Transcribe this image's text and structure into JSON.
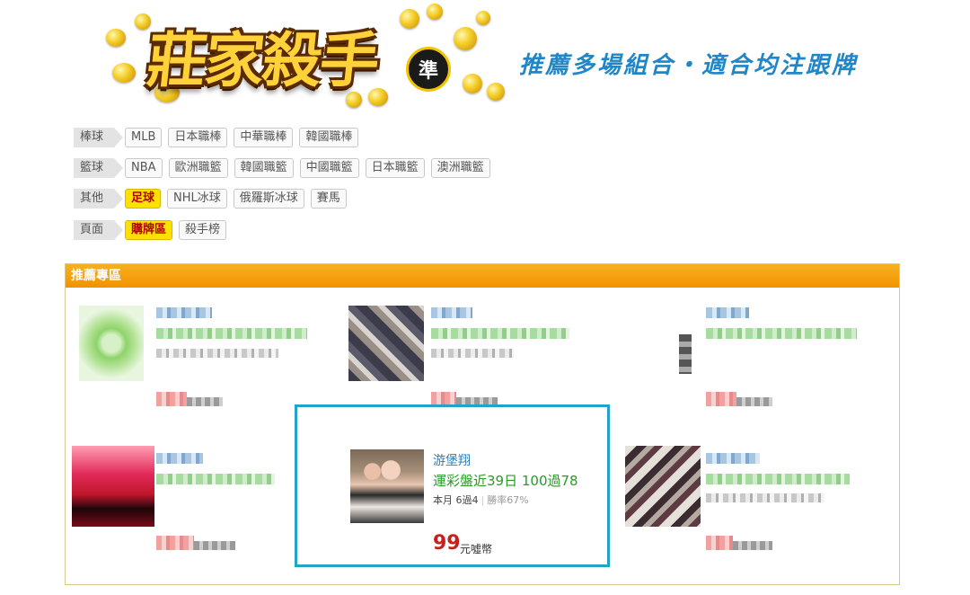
{
  "banner": {
    "logo_text": "莊家殺手",
    "logo_badge": "準",
    "tagline": "推薦多場組合・適合均注跟牌"
  },
  "categories": [
    {
      "label": "棒球",
      "tags": [
        {
          "text": "MLB"
        },
        {
          "text": "日本職棒"
        },
        {
          "text": "中華職棒"
        },
        {
          "text": "韓國職棒"
        }
      ]
    },
    {
      "label": "籃球",
      "tags": [
        {
          "text": "NBA"
        },
        {
          "text": "歐洲職籃"
        },
        {
          "text": "韓國職籃"
        },
        {
          "text": "中國職籃"
        },
        {
          "text": "日本職籃"
        },
        {
          "text": "澳洲職籃"
        }
      ]
    },
    {
      "label": "其他",
      "tags": [
        {
          "text": "足球",
          "active": true
        },
        {
          "text": "NHL冰球"
        },
        {
          "text": "俄羅斯冰球"
        },
        {
          "text": "賽馬"
        }
      ]
    },
    {
      "label": "頁面",
      "tags": [
        {
          "text": "購牌區",
          "active": true
        },
        {
          "text": "殺手榜"
        }
      ]
    }
  ],
  "recommend": {
    "title": "推薦專區",
    "featured": {
      "name": "游堡翔",
      "record": "運彩盤近39日 100過78",
      "month_record": "本月 6過4",
      "win_rate": "勝率67%",
      "price": "99",
      "currency": "元噓幣"
    }
  },
  "colors": {
    "accent_orange": "#f29200",
    "tag_active": "#ffe000",
    "tagline_blue": "#1f86c7",
    "featured_border": "#24a3c8",
    "price_red": "#c8201e",
    "record_green": "#2a9a2a"
  }
}
